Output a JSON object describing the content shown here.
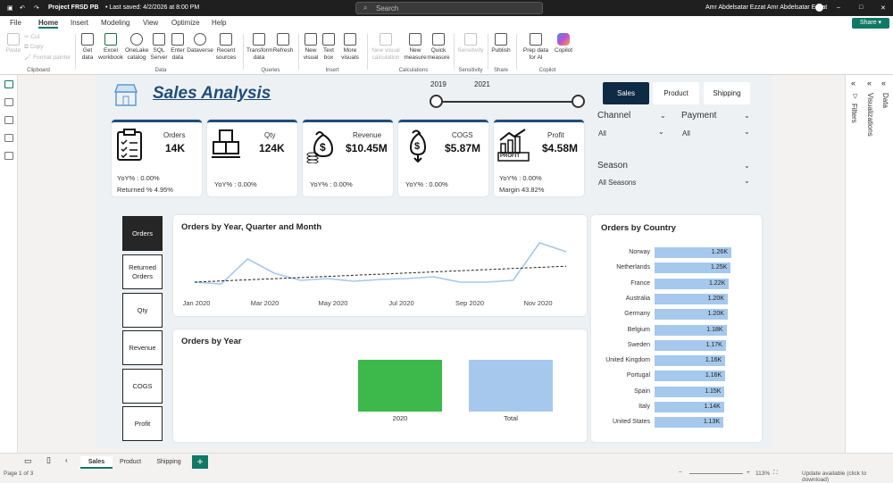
{
  "titlebar": {
    "doc_title": "Project FRSD PB",
    "saved": "• Last saved: 4/2/2026 at 8:00 PM",
    "search_placeholder": "Search",
    "user": "Amr Abdelsatar Ezzat Amr Abdelsatar Ezzat"
  },
  "menu": {
    "file": "File",
    "home": "Home",
    "insert": "Insert",
    "modeling": "Modeling",
    "view": "View",
    "optimize": "Optimize",
    "help": "Help",
    "share": "Share"
  },
  "ribbon": {
    "paste": "Paste",
    "cut": "Cut",
    "copy": "Copy",
    "format_painter": "Format painter",
    "clipboard": "Clipboard",
    "get_data": "Get data",
    "excel": "Excel workbook",
    "onelake": "OneLake catalog",
    "sql": "SQL Server",
    "enter_data": "Enter data",
    "dataverse": "Dataverse",
    "recent": "Recent sources",
    "data_group": "Data",
    "transform": "Transform data",
    "refresh": "Refresh",
    "queries_group": "Queries",
    "new_visual": "New visual",
    "text_box": "Text box",
    "more_visuals": "More visuals",
    "insert_group": "Insert",
    "new_visual_calc": "New visual calculation",
    "new_measure": "New measure",
    "quick_measure": "Quick measure",
    "calc_group": "Calculations",
    "sensitivity": "Sensitivity",
    "sensitivity_group": "Sensitivity",
    "publish": "Publish",
    "share_group": "Share",
    "prep_data": "Prep data for AI",
    "copilot": "Copilot",
    "copilot_group": "Copilot"
  },
  "panes": {
    "filters": "Filters",
    "visualizations": "Visualizations",
    "data": "Data"
  },
  "report": {
    "title": "Sales Analysis",
    "slider": {
      "from": "2019",
      "to": "2021"
    },
    "page_buttons": [
      "Sales",
      "Product",
      "Shipping"
    ],
    "kpis": [
      {
        "label": "Orders",
        "value": "14K",
        "yoy": "YoY% : 0.00%",
        "extra": "Returned % 4.95%"
      },
      {
        "label": "Qty",
        "value": "124K",
        "yoy": "YoY% : 0.00%",
        "extra": ""
      },
      {
        "label": "Revenue",
        "value": "$10.45M",
        "yoy": "YoY% : 0.00%",
        "extra": ""
      },
      {
        "label": "COGS",
        "value": "$5.87M",
        "yoy": "YoY% : 0.00%",
        "extra": ""
      },
      {
        "label": "Profit",
        "value": "$4.58M",
        "yoy": "YoY% : 0.00%",
        "extra": "Margin 43.82%",
        "badge": "PROFIT"
      }
    ],
    "slicers": {
      "channel": {
        "title": "Channel",
        "value": "All"
      },
      "payment": {
        "title": "Payment",
        "value": "All"
      },
      "season": {
        "title": "Season",
        "value": "All Seasons"
      }
    },
    "measure_buttons": [
      "Orders",
      "Returned Orders",
      "Qty",
      "Revenue",
      "COGS",
      "Profit"
    ]
  },
  "chart_data": [
    {
      "type": "line",
      "title": "Orders by Year, Quarter and Month",
      "x_ticks": [
        "Jan 2020",
        "Mar 2020",
        "May 2020",
        "Jul 2020",
        "Sep 2020",
        "Nov 2020"
      ],
      "series": [
        {
          "values": [
            560,
            540,
            820,
            660,
            580,
            600,
            570,
            590,
            600,
            620,
            560,
            560,
            580,
            1000,
            900
          ]
        }
      ],
      "trendline": true,
      "color": "#a6c8ec"
    },
    {
      "type": "bar",
      "title": "Orders by Year",
      "categories": [
        "2020",
        "Total"
      ],
      "values": [
        14,
        14
      ],
      "colors": [
        "#3cb94a",
        "#a6c8ec"
      ]
    },
    {
      "type": "bar",
      "orientation": "horizontal",
      "title": "Orders by Country",
      "categories": [
        "Norway",
        "Netherlands",
        "France",
        "Australia",
        "Germany",
        "Belgium",
        "Sweden",
        "United Kingdom",
        "Portugal",
        "Spain",
        "Italy",
        "United States"
      ],
      "values": [
        1.26,
        1.25,
        1.22,
        1.2,
        1.2,
        1.18,
        1.17,
        1.16,
        1.16,
        1.15,
        1.14,
        1.13
      ],
      "labels": [
        "1.26K",
        "1.25K",
        "1.22K",
        "1.20K",
        "1.20K",
        "1.18K",
        "1.17K",
        "1.16K",
        "1.16K",
        "1.15K",
        "1.14K",
        "1.13K"
      ],
      "color": "#a6c8ec"
    }
  ],
  "page_tabs": [
    "Sales",
    "Product",
    "Shipping"
  ],
  "status": {
    "page": "Page 1 of 3",
    "zoom": "113%",
    "update": "Update available (click to download)"
  }
}
